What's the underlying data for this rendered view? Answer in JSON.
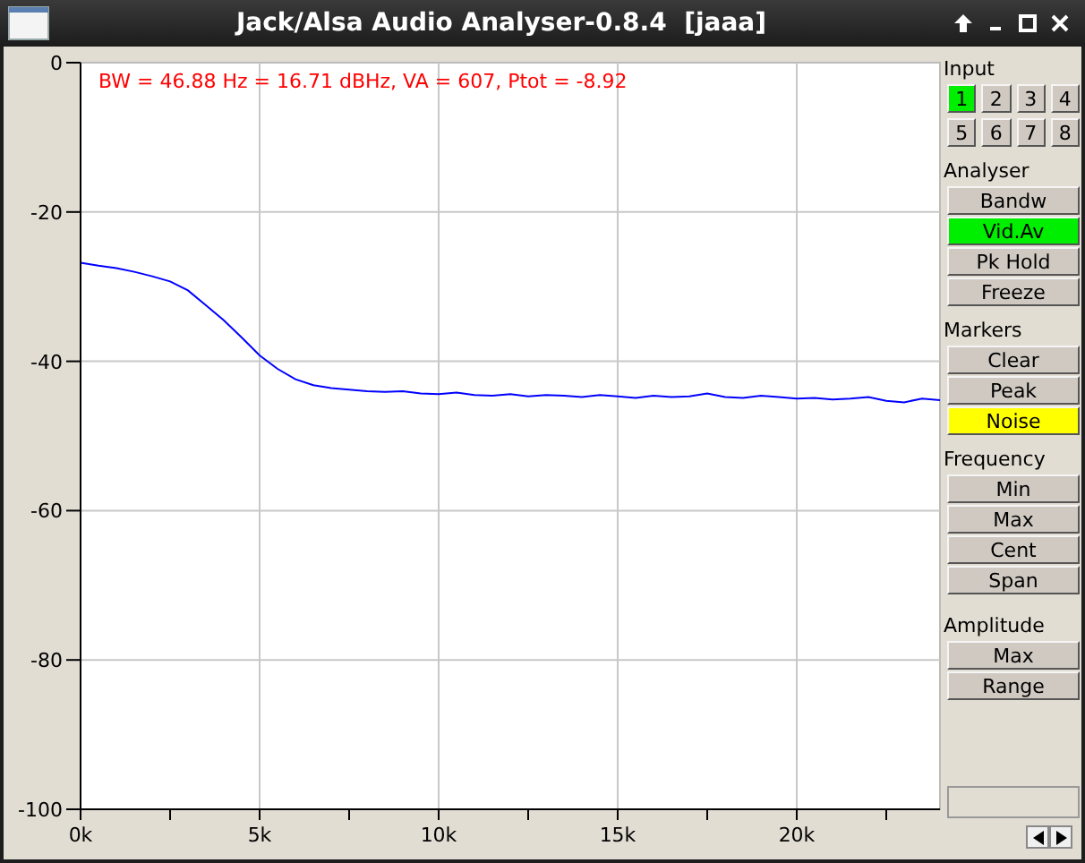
{
  "window": {
    "title": "Jack/Alsa Audio Analyser-0.8.4  [jaaa]"
  },
  "plot": {
    "info": "BW = 46.88 Hz = 16.71 dBHz, VA = 607, Ptot = -8.92",
    "chart_data": {
      "type": "line",
      "grid": true,
      "x": [
        0,
        0.5,
        1,
        1.5,
        2,
        2.5,
        3,
        3.5,
        4,
        4.5,
        5,
        5.5,
        6,
        6.5,
        7,
        7.5,
        8,
        8.5,
        9,
        9.5,
        10,
        10.5,
        11,
        11.5,
        12,
        12.5,
        13,
        13.5,
        14,
        14.5,
        15,
        15.5,
        16,
        16.5,
        17,
        17.5,
        18,
        18.5,
        19,
        19.5,
        20,
        20.5,
        21,
        21.5,
        22,
        22.5,
        23,
        23.5,
        24
      ],
      "series": [
        {
          "color": "#0000ff",
          "values": [
            -26.8,
            -27.2,
            -27.5,
            -28.0,
            -28.6,
            -29.3,
            -30.5,
            -32.5,
            -34.5,
            -36.8,
            -39.2,
            -41.0,
            -42.4,
            -43.2,
            -43.6,
            -43.8,
            -44.0,
            -44.1,
            -44.0,
            -44.3,
            -44.4,
            -44.2,
            -44.5,
            -44.6,
            -44.4,
            -44.7,
            -44.5,
            -44.6,
            -44.8,
            -44.5,
            -44.7,
            -44.9,
            -44.6,
            -44.8,
            -44.7,
            -44.3,
            -44.8,
            -44.9,
            -44.6,
            -44.8,
            -45.0,
            -44.9,
            -45.1,
            -45.0,
            -44.8,
            -45.3,
            -45.5,
            -45.0,
            -45.2
          ]
        }
      ],
      "xlim": [
        0,
        24
      ],
      "ylim": [
        -100,
        0
      ],
      "xticks": [
        {
          "value": 0,
          "label": "0k"
        },
        {
          "value": 5,
          "label": "5k"
        },
        {
          "value": 10,
          "label": "10k"
        },
        {
          "value": 15,
          "label": "15k"
        },
        {
          "value": 20,
          "label": "20k"
        }
      ],
      "yticks": [
        0,
        -20,
        -40,
        -60,
        -80,
        -100
      ]
    }
  },
  "sidebar": {
    "sections": [
      {
        "title": "Input",
        "kind": "grid",
        "buttons": [
          {
            "label": "1",
            "on": true,
            "color": "#00ee00"
          },
          {
            "label": "2",
            "on": false
          },
          {
            "label": "3",
            "on": false
          },
          {
            "label": "4",
            "on": false
          },
          {
            "label": "5",
            "on": false
          },
          {
            "label": "6",
            "on": false
          },
          {
            "label": "7",
            "on": false
          },
          {
            "label": "8",
            "on": false
          }
        ]
      },
      {
        "title": "Analyser",
        "kind": "list",
        "buttons": [
          {
            "label": "Bandw",
            "on": false
          },
          {
            "label": "Vid.Av",
            "on": true,
            "color": "#00ee00"
          },
          {
            "label": "Pk Hold",
            "on": false
          },
          {
            "label": "Freeze",
            "on": false
          }
        ]
      },
      {
        "title": "Markers",
        "kind": "list",
        "buttons": [
          {
            "label": "Clear",
            "on": false
          },
          {
            "label": "Peak",
            "on": false
          },
          {
            "label": "Noise",
            "on": true,
            "color": "#ffff00"
          }
        ]
      },
      {
        "title": "Frequency",
        "kind": "list",
        "buttons": [
          {
            "label": "Min",
            "on": false
          },
          {
            "label": "Max",
            "on": false
          },
          {
            "label": "Cent",
            "on": false
          },
          {
            "label": "Span",
            "on": false
          }
        ]
      },
      {
        "title": "Amplitude",
        "kind": "list",
        "buttons": [
          {
            "label": "Max",
            "on": false
          },
          {
            "label": "Range",
            "on": false
          }
        ]
      }
    ]
  }
}
